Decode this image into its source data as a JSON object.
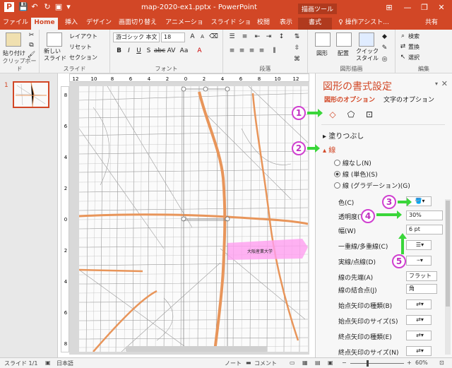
{
  "titlebar": {
    "title": "map-2020-ex1.pptx - PowerPoint",
    "context_tab": "描画ツール",
    "min": "—",
    "max": "❐",
    "close": "✕",
    "options": "⊞"
  },
  "tabs": [
    {
      "label": "ファイル"
    },
    {
      "label": "Home"
    },
    {
      "label": "挿入"
    },
    {
      "label": "デザイン"
    },
    {
      "label": "画面切り替え"
    },
    {
      "label": "アニメーション"
    },
    {
      "label": "スライド ショー"
    },
    {
      "label": "校閲"
    },
    {
      "label": "表示"
    },
    {
      "label": "書式"
    },
    {
      "label": "♀ 操作アシスト..."
    },
    {
      "label": "共有"
    }
  ],
  "ribbon": {
    "clipboard": {
      "paste": "貼り付け",
      "label": "クリップボード"
    },
    "slides": {
      "new_slide": "新しい\nスライド",
      "layout": "レイアウト",
      "reset": "リセット",
      "section": "セクション",
      "label": "スライド"
    },
    "font": {
      "name": "游ゴシック 本文",
      "size": "18",
      "label": "フォント"
    },
    "paragraph": {
      "label": "段落"
    },
    "drawing": {
      "shape": "図形",
      "arrange": "配置",
      "quick_style": "クイック\nスタイル",
      "label": "図形描画"
    },
    "editing": {
      "find": "検索",
      "replace": "置換",
      "select": "選択",
      "label": "編集"
    }
  },
  "slide_thumbnail": {
    "number": "1"
  },
  "ruler_h": [
    "12",
    "10",
    "8",
    "6",
    "4",
    "2",
    "0",
    "2",
    "4",
    "6",
    "8",
    "10",
    "12"
  ],
  "ruler_v": [
    "8",
    "6",
    "4",
    "2",
    "0",
    "2",
    "4",
    "6",
    "8"
  ],
  "map": {
    "label_univ": "大阪産業大学",
    "colors": {
      "road": "#e8955a",
      "highlight": "#ff9ff0",
      "frame": "#888888"
    }
  },
  "pane": {
    "title": "図形の書式設定",
    "tab_shape": "図形のオプション",
    "tab_text": "文字のオプション",
    "fill": "塗りつぶし",
    "line": "線",
    "no_line": "線なし(N)",
    "solid_line": "線 (単色)(S)",
    "gradient_line": "線 (グラデーション)(G)",
    "color": "色(C)",
    "transparency": "透明度(T)",
    "transparency_value": "30%",
    "width": "幅(W)",
    "width_value": "6 pt",
    "compound": "一重線/多重線(C)",
    "dash": "実線/点線(D)",
    "cap": "線の先端(A)",
    "cap_value": "フラット",
    "join": "線の結合点(J)",
    "join_value": "角",
    "begin_arrow_type": "始点矢印の種類(B)",
    "begin_arrow_size": "始点矢印のサイズ(S)",
    "end_arrow_type": "終点矢印の種類(E)",
    "end_arrow_size": "終点矢印のサイズ(N)"
  },
  "annotations": [
    "1",
    "2",
    "3",
    "4",
    "5"
  ],
  "status": {
    "slide": "スライド 1/1",
    "lang": "日本語",
    "notes": "ノート",
    "comments": "コメント",
    "zoom": "60%"
  }
}
